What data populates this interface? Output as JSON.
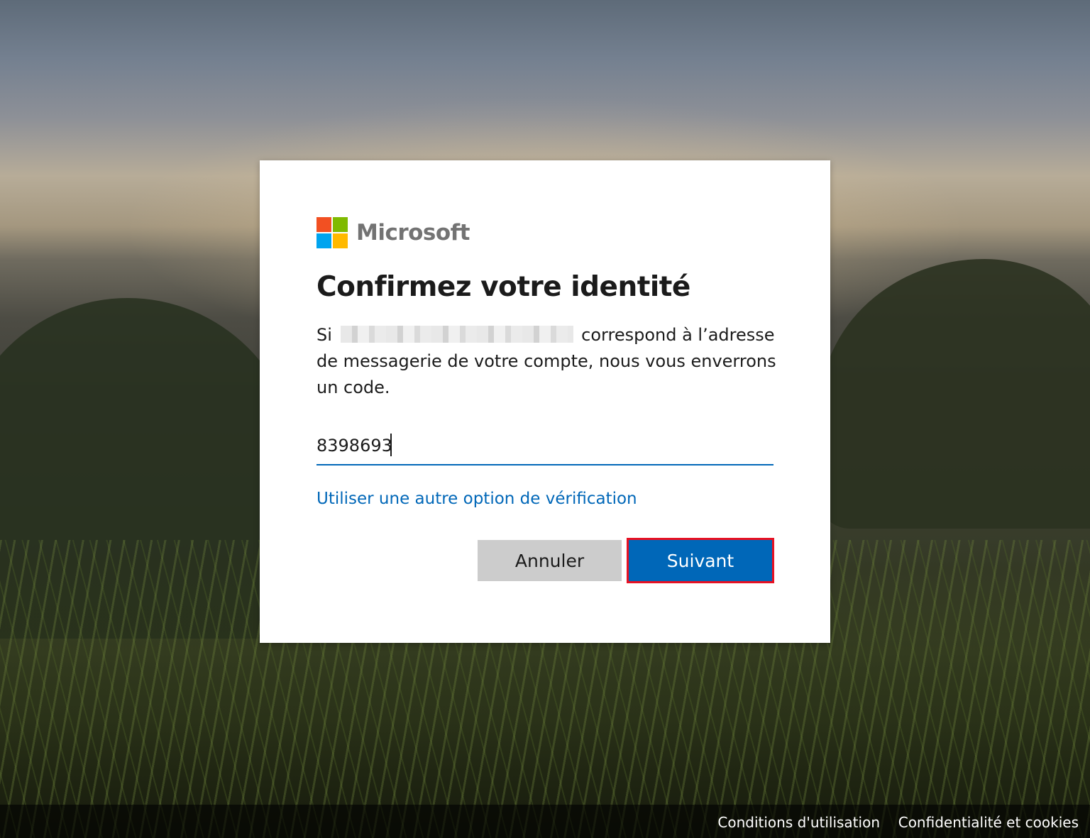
{
  "brand": {
    "name": "Microsoft",
    "logo_colors": [
      "#f25022",
      "#7fba00",
      "#00a4ef",
      "#ffb900"
    ]
  },
  "dialog": {
    "title": "Confirmez votre identité",
    "description": {
      "prefix": "Si",
      "suffix": "correspond à l’adresse de messagerie de votre compte, nous vous enverrons un code."
    },
    "code_input": {
      "value": "8398693"
    },
    "alt_option_link": "Utiliser une autre option de vérification",
    "buttons": {
      "cancel": "Annuler",
      "next": "Suivant"
    }
  },
  "footer": {
    "terms": "Conditions d'utilisation",
    "privacy": "Confidentialité et cookies"
  },
  "colors": {
    "accent": "#0067b8",
    "highlight_border": "#e81123"
  }
}
